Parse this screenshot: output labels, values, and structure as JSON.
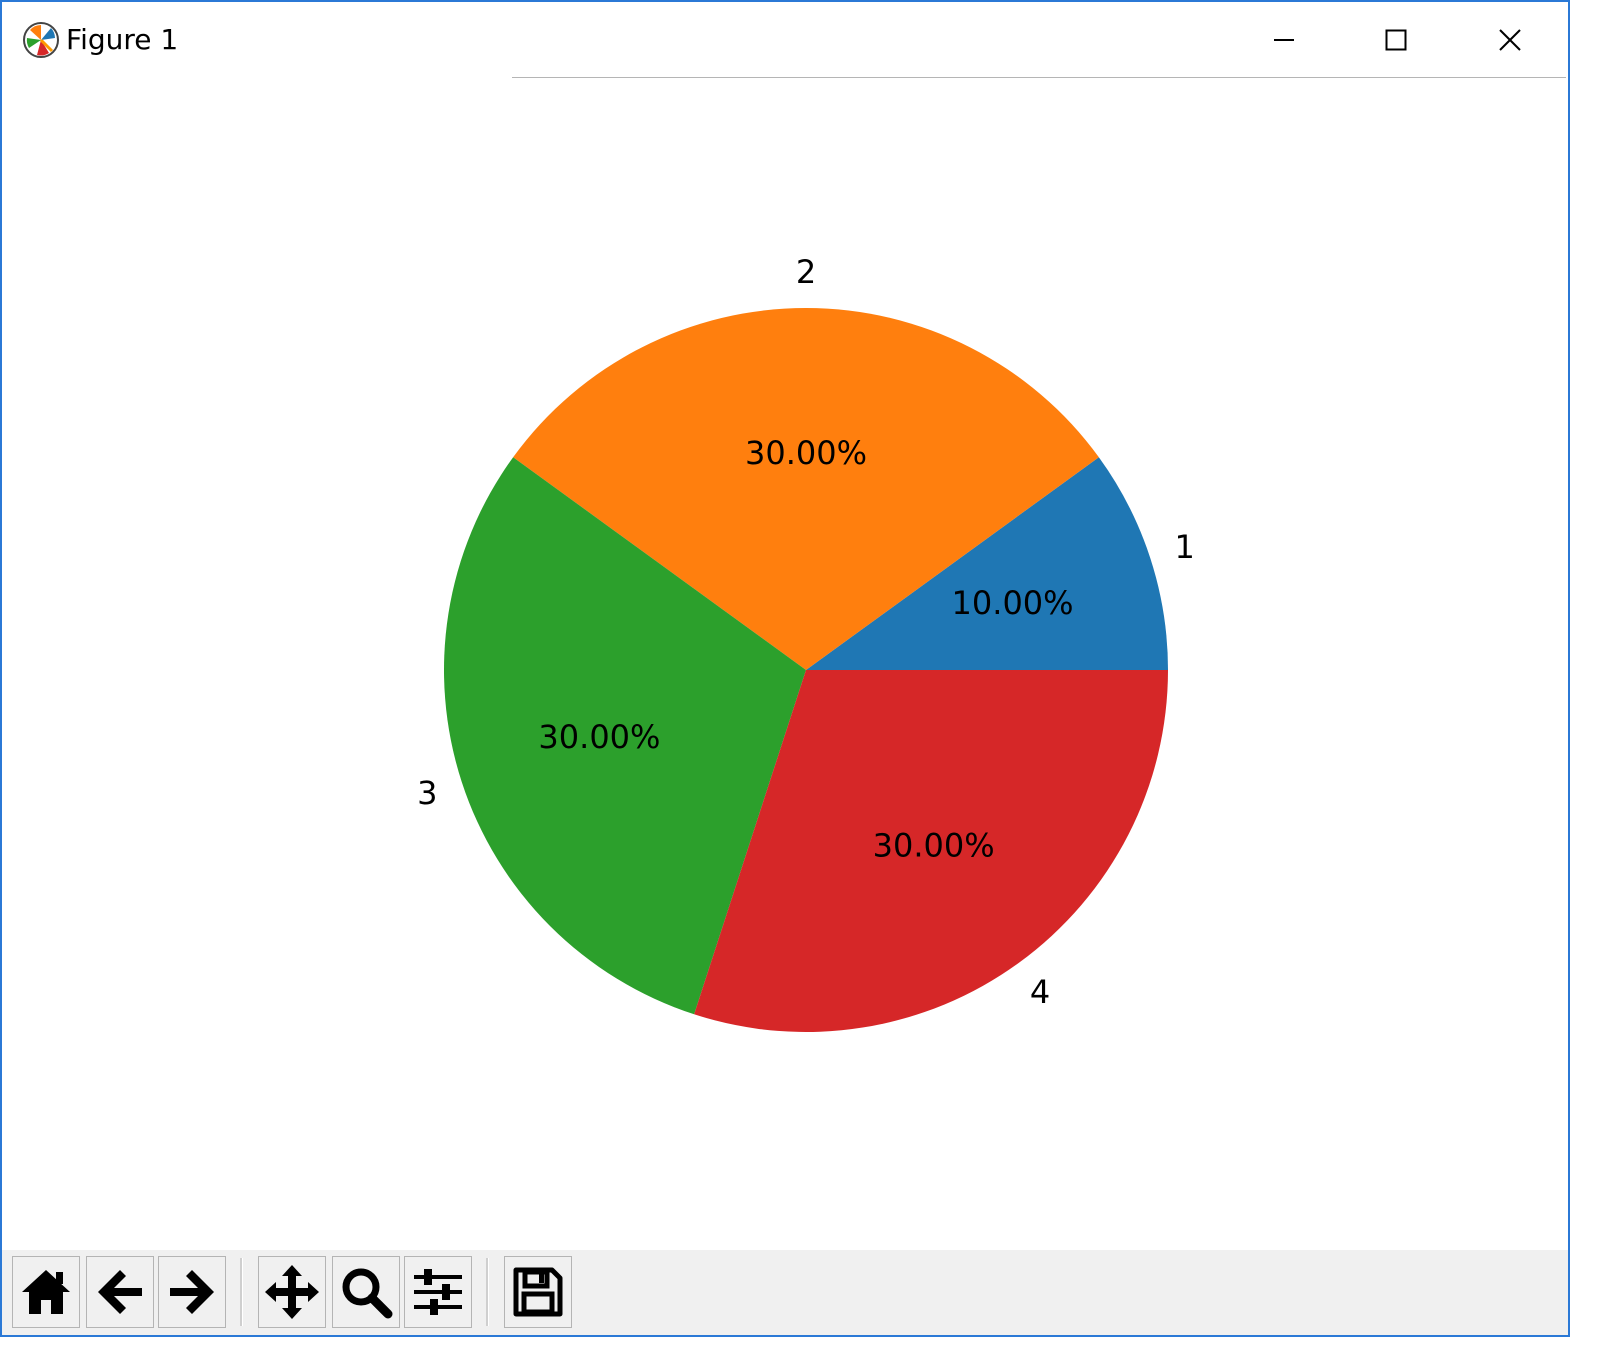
{
  "window": {
    "title": "Figure 1",
    "app_icon": "matplotlib-icon",
    "controls": [
      "minimize-icon",
      "maximize-icon",
      "close-icon"
    ]
  },
  "toolbar": {
    "buttons": [
      {
        "name": "home-button",
        "icon": "home-icon"
      },
      {
        "name": "back-button",
        "icon": "arrow-left-icon"
      },
      {
        "name": "forward-button",
        "icon": "arrow-right-icon"
      },
      {
        "name": "pan-button",
        "icon": "move-icon"
      },
      {
        "name": "zoom-button",
        "icon": "magnifier-icon"
      },
      {
        "name": "configure-subplots-button",
        "icon": "sliders-icon"
      },
      {
        "name": "save-button",
        "icon": "floppy-disk-icon"
      }
    ]
  },
  "chart_data": {
    "type": "pie",
    "title": "",
    "categories": [
      "1",
      "2",
      "3",
      "4"
    ],
    "values": [
      10,
      30,
      30,
      30
    ],
    "percent_labels": [
      "10.00%",
      "30.00%",
      "30.00%",
      "30.00%"
    ],
    "colors": [
      "#1f77b4",
      "#ff7f0e",
      "#2ca02c",
      "#d62728"
    ],
    "start_angle": 0,
    "direction": "counterclockwise"
  }
}
